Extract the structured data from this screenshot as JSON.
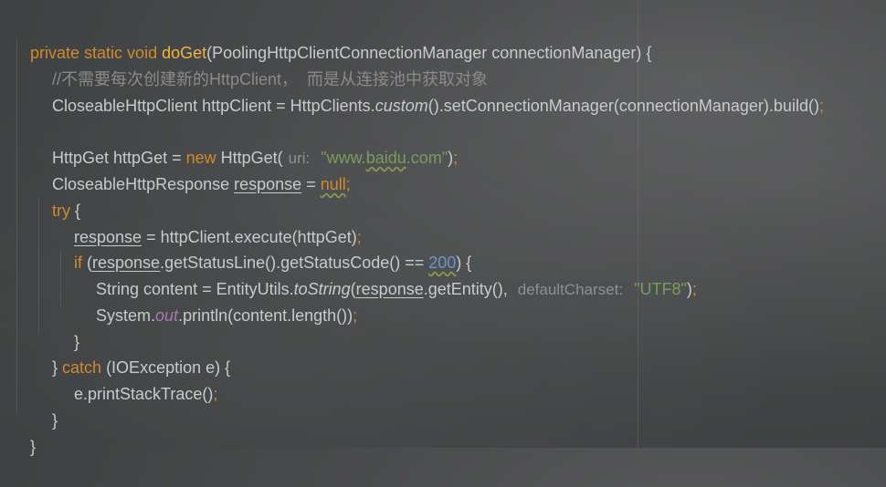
{
  "code": {
    "l1": {
      "mods": "private static void ",
      "method": "doGet",
      "params": "(PoolingHttpClientConnectionManager connectionManager) {"
    },
    "l2": {
      "comment": "//不需要每次创建新的HttpClient，  而是从连接池中获取对象"
    },
    "l3": {
      "a": "CloseableHttpClient httpClient = HttpClients.",
      "custom": "custom",
      "b": "().setConnectionManager(connectionManager).build()",
      "semi": ";"
    },
    "l5": {
      "a": "HttpGet httpGet = ",
      "new": "new",
      "b": " HttpGet(",
      "hint": "uri:",
      "q1": "\"www.",
      "baidu": "baidu",
      "q2": ".com\"",
      "c": ")",
      "semi": ";"
    },
    "l6": {
      "a": "CloseableHttpResponse ",
      "var": "response",
      "b": " = ",
      "null": "null",
      "semi": ";"
    },
    "l7": {
      "try": "try",
      "b": " {"
    },
    "l8": {
      "var": "response",
      "b": " = httpClient.execute(httpGet)",
      "semi": ";"
    },
    "l9": {
      "if": "if",
      "a": " (",
      "var": "response",
      "b": ".getStatusLine().getStatusCode() == ",
      "num": "200",
      "c": ") {"
    },
    "l10": {
      "a": "String content = EntityUtils.",
      "tostr": "toString",
      "b": "(",
      "var": "response",
      "c": ".getEntity(), ",
      "hint": "defaultCharset:",
      "str": "\"UTF8\"",
      "d": ")",
      "semi": ";"
    },
    "l11": {
      "a": "System.",
      "out": "out",
      "b": ".println(content.length())",
      "semi": ";"
    },
    "l12": {
      "brace": "}"
    },
    "l13": {
      "a": "} ",
      "catch": "catch",
      "b": " (IOException e) {"
    },
    "l14": {
      "a": "e.printStackTrace()",
      "semi": ";"
    },
    "l15": {
      "brace": "}"
    },
    "l16": {
      "brace": "}"
    }
  }
}
